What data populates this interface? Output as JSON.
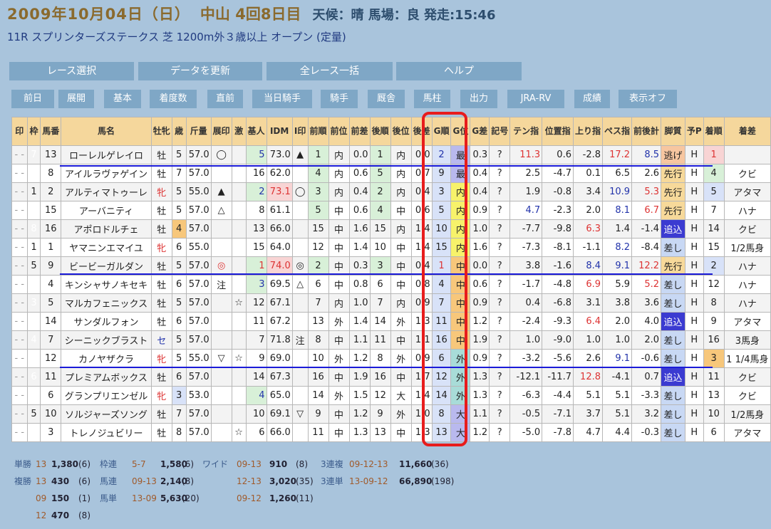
{
  "header": {
    "date": "2009年10月04日（日）",
    "place": "中山 4回8日目",
    "weather": "天候：晴 馬場：良 発走:15:46"
  },
  "race": "11R  スプリンターズステークス  芝 1200m外３歳以上 オープン (定量)",
  "nav": [
    "レース選択",
    "データを更新",
    "全レース一括",
    "ヘルプ"
  ],
  "toolbar": [
    "前日",
    "展開",
    "基本",
    "着度数",
    "直前",
    "当日騎手",
    "騎手",
    "厩舎",
    "馬柱",
    "出力",
    "JRA-RV",
    "成績",
    "表示オフ"
  ],
  "columns": [
    "印",
    "枠",
    "馬番",
    "馬名",
    "牡牝",
    "歳",
    "斤量",
    "展印",
    "激",
    "基人",
    "IDM",
    "I印",
    "前順",
    "前位",
    "前差",
    "後順",
    "後位",
    "後差",
    "G順",
    "G位",
    "G差",
    "記号",
    "テン指",
    "位置指",
    "上り指",
    "ペス指",
    "前後計",
    "脚質",
    "予P",
    "着順",
    "着差"
  ],
  "rows": [
    {
      "waku": "7",
      "ban": "13",
      "name": "ローレルゲレイロ",
      "sex": "牡",
      "age": "5",
      "kin": "57.0",
      "ten": "◯",
      "geki": "",
      "kihon": "5",
      "idm": "73.0",
      "ii": "▲",
      "mj": "1",
      "mi": "内",
      "ms": "0.0",
      "aj": "1",
      "ai": "内",
      "as": "0.0",
      "gj": "2",
      "gi": "最",
      "gs": "0.3",
      "ki": "?",
      "tenshi": "11.3",
      "ichi": "0.6",
      "agari": "-2.8",
      "pace": "17.2",
      "zengo": "8.5",
      "kyaku": "逃げ",
      "yo": "H",
      "chaku": "1",
      "sa": ""
    },
    {
      "waku": "4",
      "ban": "8",
      "name": "アイルラヴァゲイン",
      "sex": "牡",
      "age": "7",
      "kin": "57.0",
      "ten": "",
      "geki": "",
      "kihon": "16",
      "idm": "62.0",
      "ii": "",
      "mj": "4",
      "mi": "内",
      "ms": "0.6",
      "aj": "5",
      "ai": "内",
      "as": "0.7",
      "gj": "9",
      "gi": "最",
      "gs": "0.4",
      "ki": "?",
      "tenshi": "2.5",
      "ichi": "-4.7",
      "agari": "0.1",
      "pace": "6.5",
      "zengo": "2.6",
      "kyaku": "先行",
      "yo": "H",
      "chaku": "4",
      "sa": "クビ"
    },
    {
      "waku": "1",
      "ban": "2",
      "name": "アルティマトゥーレ",
      "sex": "牝",
      "age": "5",
      "kin": "55.0",
      "ten": "▲",
      "geki": "",
      "kihon": "2",
      "idm": "73.1",
      "ii": "◯",
      "mj": "3",
      "mi": "内",
      "ms": "0.4",
      "aj": "2",
      "ai": "内",
      "as": "0.4",
      "gj": "3",
      "gi": "内",
      "gs": "0.4",
      "ki": "?",
      "tenshi": "1.9",
      "ichi": "-0.8",
      "agari": "3.4",
      "pace": "10.9",
      "zengo": "5.3",
      "kyaku": "先行",
      "yo": "H",
      "chaku": "5",
      "sa": "アタマ"
    },
    {
      "waku": "8",
      "ban": "15",
      "name": "アーバニティ",
      "sex": "牡",
      "age": "5",
      "kin": "57.0",
      "ten": "△",
      "geki": "",
      "kihon": "8",
      "idm": "61.1",
      "ii": "",
      "mj": "5",
      "mi": "中",
      "ms": "0.6",
      "aj": "4",
      "ai": "中",
      "as": "0.6",
      "gj": "5",
      "gi": "内",
      "gs": "0.9",
      "ki": "?",
      "tenshi": "4.7",
      "ichi": "-2.3",
      "agari": "2.0",
      "pace": "8.1",
      "zengo": "6.7",
      "kyaku": "先行",
      "yo": "H",
      "chaku": "7",
      "sa": "ハナ"
    },
    {
      "waku": "8",
      "ban": "16",
      "name": "アポロドルチェ",
      "sex": "牡",
      "age": "4",
      "kin": "57.0",
      "ten": "",
      "geki": "",
      "kihon": "13",
      "idm": "66.0",
      "ii": "",
      "mj": "15",
      "mi": "中",
      "ms": "1.6",
      "aj": "15",
      "ai": "内",
      "as": "1.4",
      "gj": "10",
      "gi": "内",
      "gs": "1.0",
      "ki": "?",
      "tenshi": "-7.7",
      "ichi": "-9.8",
      "agari": "6.3",
      "pace": "1.4",
      "zengo": "-1.4",
      "kyaku": "追込",
      "yo": "H",
      "chaku": "14",
      "sa": "クビ"
    },
    {
      "waku": "1",
      "ban": "1",
      "name": "ヤマニンエマイユ",
      "sex": "牝",
      "age": "6",
      "kin": "55.0",
      "ten": "",
      "geki": "",
      "kihon": "15",
      "idm": "64.0",
      "ii": "",
      "mj": "12",
      "mi": "中",
      "ms": "1.4",
      "aj": "10",
      "ai": "中",
      "as": "1.4",
      "gj": "15",
      "gi": "内",
      "gs": "1.6",
      "ki": "?",
      "tenshi": "-7.3",
      "ichi": "-8.1",
      "agari": "-1.1",
      "pace": "8.2",
      "zengo": "-8.4",
      "kyaku": "差し",
      "yo": "H",
      "chaku": "15",
      "sa": "1/2馬身"
    },
    {
      "waku": "5",
      "ban": "9",
      "name": "ビービーガルダン",
      "sex": "牡",
      "age": "5",
      "kin": "57.0",
      "ten": "◎",
      "geki": "",
      "kihon": "1",
      "idm": "74.0",
      "ii": "◎",
      "mj": "2",
      "mi": "中",
      "ms": "0.3",
      "aj": "3",
      "ai": "中",
      "as": "0.4",
      "gj": "1",
      "gi": "中",
      "gs": "0.0",
      "ki": "?",
      "tenshi": "3.8",
      "ichi": "-1.6",
      "agari": "8.4",
      "pace": "9.1",
      "zengo": "12.2",
      "kyaku": "先行",
      "yo": "H",
      "chaku": "2",
      "sa": "ハナ"
    },
    {
      "waku": "2",
      "ban": "4",
      "name": "キンシャサノキセキ",
      "sex": "牡",
      "age": "6",
      "kin": "57.0",
      "ten": "注",
      "geki": "",
      "kihon": "3",
      "idm": "69.5",
      "ii": "△",
      "mj": "6",
      "mi": "中",
      "ms": "0.8",
      "aj": "6",
      "ai": "中",
      "as": "0.8",
      "gj": "4",
      "gi": "中",
      "gs": "0.6",
      "ki": "?",
      "tenshi": "-1.7",
      "ichi": "-4.8",
      "agari": "6.9",
      "pace": "5.9",
      "zengo": "5.2",
      "kyaku": "差し",
      "yo": "H",
      "chaku": "12",
      "sa": "ハナ"
    },
    {
      "waku": "3",
      "ban": "5",
      "name": "マルカフェニックス",
      "sex": "牡",
      "age": "5",
      "kin": "57.0",
      "ten": "",
      "geki": "☆",
      "kihon": "12",
      "idm": "67.1",
      "ii": "",
      "mj": "7",
      "mi": "内",
      "ms": "1.0",
      "aj": "7",
      "ai": "内",
      "as": "0.9",
      "gj": "7",
      "gi": "中",
      "gs": "0.9",
      "ki": "?",
      "tenshi": "0.4",
      "ichi": "-6.8",
      "agari": "3.1",
      "pace": "3.8",
      "zengo": "3.6",
      "kyaku": "差し",
      "yo": "H",
      "chaku": "8",
      "sa": "ハナ"
    },
    {
      "waku": "7",
      "ban": "14",
      "name": "サンダルフォン",
      "sex": "牡",
      "age": "6",
      "kin": "57.0",
      "ten": "",
      "geki": "",
      "kihon": "11",
      "idm": "67.2",
      "ii": "",
      "mj": "13",
      "mi": "外",
      "ms": "1.4",
      "aj": "14",
      "ai": "外",
      "as": "1.3",
      "gj": "11",
      "gi": "中",
      "gs": "1.2",
      "ki": "?",
      "tenshi": "-2.4",
      "ichi": "-9.3",
      "agari": "6.4",
      "pace": "2.0",
      "zengo": "4.0",
      "kyaku": "追込",
      "yo": "H",
      "chaku": "9",
      "sa": "アタマ"
    },
    {
      "waku": "4",
      "ban": "7",
      "name": "シーニックブラスト",
      "sex": "セ",
      "age": "5",
      "kin": "57.0",
      "ten": "",
      "geki": "",
      "kihon": "7",
      "idm": "71.8",
      "ii": "注",
      "mj": "8",
      "mi": "中",
      "ms": "1.1",
      "aj": "11",
      "ai": "中",
      "as": "1.1",
      "gj": "16",
      "gi": "中",
      "gs": "1.9",
      "ki": "?",
      "tenshi": "1.0",
      "ichi": "-9.0",
      "agari": "1.0",
      "pace": "1.0",
      "zengo": "2.0",
      "kyaku": "差し",
      "yo": "H",
      "chaku": "16",
      "sa": "3馬身"
    },
    {
      "waku": "6",
      "ban": "12",
      "name": "カノヤザクラ",
      "sex": "牝",
      "age": "5",
      "kin": "55.0",
      "ten": "▽",
      "geki": "☆",
      "kihon": "9",
      "idm": "69.0",
      "ii": "",
      "mj": "10",
      "mi": "外",
      "ms": "1.2",
      "aj": "8",
      "ai": "外",
      "as": "0.9",
      "gj": "6",
      "gi": "外",
      "gs": "0.9",
      "ki": "?",
      "tenshi": "-3.2",
      "ichi": "-5.6",
      "agari": "2.6",
      "pace": "9.1",
      "zengo": "-0.6",
      "kyaku": "差し",
      "yo": "H",
      "chaku": "3",
      "sa": "1 1/4馬身"
    },
    {
      "waku": "6",
      "ban": "11",
      "name": "プレミアムボックス",
      "sex": "牡",
      "age": "6",
      "kin": "57.0",
      "ten": "",
      "geki": "",
      "kihon": "14",
      "idm": "67.3",
      "ii": "",
      "mj": "16",
      "mi": "中",
      "ms": "1.9",
      "aj": "16",
      "ai": "中",
      "as": "1.7",
      "gj": "12",
      "gi": "外",
      "gs": "1.3",
      "ki": "?",
      "tenshi": "-12.1",
      "ichi": "-11.7",
      "agari": "12.8",
      "pace": "-4.1",
      "zengo": "0.7",
      "kyaku": "追込",
      "yo": "H",
      "chaku": "11",
      "sa": "クビ"
    },
    {
      "waku": "3",
      "ban": "6",
      "name": "グランプリエンゼル",
      "sex": "牝",
      "age": "3",
      "kin": "53.0",
      "ten": "",
      "geki": "",
      "kihon": "4",
      "idm": "65.0",
      "ii": "",
      "mj": "14",
      "mi": "外",
      "ms": "1.5",
      "aj": "12",
      "ai": "大",
      "as": "1.4",
      "gj": "14",
      "gi": "外",
      "gs": "1.3",
      "ki": "?",
      "tenshi": "-6.3",
      "ichi": "-4.4",
      "agari": "5.1",
      "pace": "5.1",
      "zengo": "-3.3",
      "kyaku": "差し",
      "yo": "H",
      "chaku": "13",
      "sa": "クビ"
    },
    {
      "waku": "5",
      "ban": "10",
      "name": "ソルジャーズソング",
      "sex": "牡",
      "age": "7",
      "kin": "57.0",
      "ten": "",
      "geki": "",
      "kihon": "10",
      "idm": "69.1",
      "ii": "▽",
      "mj": "9",
      "mi": "中",
      "ms": "1.2",
      "aj": "9",
      "ai": "外",
      "as": "1.0",
      "gj": "8",
      "gi": "大",
      "gs": "1.1",
      "ki": "?",
      "tenshi": "-0.5",
      "ichi": "-7.1",
      "agari": "3.7",
      "pace": "5.1",
      "zengo": "3.2",
      "kyaku": "差し",
      "yo": "H",
      "chaku": "10",
      "sa": "1/2馬身"
    },
    {
      "waku": "2",
      "ban": "3",
      "name": "トレノジュビリー",
      "sex": "牡",
      "age": "8",
      "kin": "57.0",
      "ten": "",
      "geki": "☆",
      "kihon": "6",
      "idm": "66.0",
      "ii": "",
      "mj": "11",
      "mi": "中",
      "ms": "1.3",
      "aj": "13",
      "ai": "中",
      "as": "1.3",
      "gj": "13",
      "gi": "大",
      "gs": "1.2",
      "ki": "?",
      "tenshi": "-5.0",
      "ichi": "-7.8",
      "agari": "4.7",
      "pace": "4.4",
      "zengo": "-0.3",
      "kyaku": "差し",
      "yo": "H",
      "chaku": "6",
      "sa": "アタマ"
    }
  ],
  "payouts": [
    [
      [
        "単勝",
        "13",
        "1,380",
        "(6)"
      ],
      [
        "枠連",
        "5-7",
        "1,580",
        "(6)"
      ],
      [
        "ワイド",
        "09-13",
        "910",
        "(8)"
      ],
      [
        "3連複",
        "09-12-13",
        "11,660",
        "(36)"
      ]
    ],
    [
      [
        "複勝",
        "13",
        "430",
        "(6)"
      ],
      [
        "馬連",
        "09-13",
        "2,140",
        "(8)"
      ],
      [
        "",
        "12-13",
        "3,020",
        "(35)"
      ],
      [
        "3連単",
        "13-09-12",
        "66,890",
        "(198)"
      ]
    ],
    [
      [
        "",
        "09",
        "150",
        "(1)"
      ],
      [
        "馬単",
        "13-09",
        "5,630",
        "(20)"
      ],
      [
        "",
        "09-12",
        "1,260",
        "(11)"
      ]
    ],
    [
      [
        "",
        "12",
        "470",
        "(8)"
      ]
    ]
  ],
  "colors": {
    "accent_red": "#e81c1c",
    "line_blue": "#1a1ad8",
    "button": "#7fa7c6"
  }
}
